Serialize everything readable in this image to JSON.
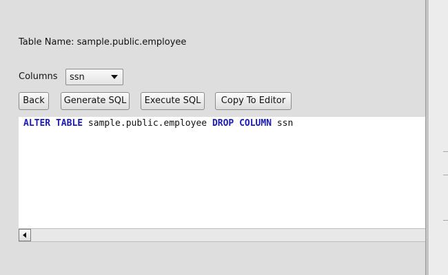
{
  "table_name_line": "Table Name: sample.public.employee",
  "columns": {
    "label": "Columns",
    "selected": "ssn"
  },
  "buttons": {
    "back": "Back",
    "generate": "Generate SQL",
    "execute": "Execute SQL",
    "copy": "Copy To Editor"
  },
  "sql": {
    "kw1": "ALTER TABLE",
    "table": "sample.public.employee",
    "kw2": "DROP COLUMN",
    "column": "ssn"
  },
  "colors": {
    "background": "#dedede",
    "keyword": "#1a1ab8",
    "editor_bg": "#ffffff"
  },
  "icons": {
    "dropdown": "chevron-down-icon",
    "scroll_left": "arrow-left-icon"
  }
}
